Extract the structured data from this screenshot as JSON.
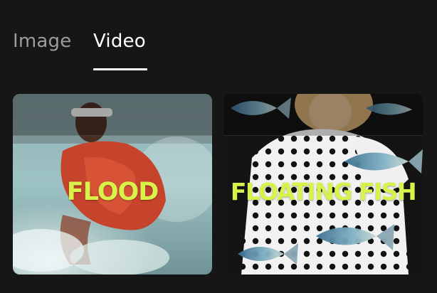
{
  "tabs": [
    {
      "label": "Image",
      "selected": false
    },
    {
      "label": "Video",
      "selected": true
    }
  ],
  "cards": [
    {
      "label": "FLOOD",
      "thumbnail": "woman-in-red-jacket-splashing-water"
    },
    {
      "label": "FLOATING FISH",
      "thumbnail": "woman-in-polka-dot-shirt-with-fish"
    }
  ],
  "colors": {
    "background": "#161616",
    "tab_active": "#ffffff",
    "tab_inactive": "#9c9c9c",
    "card_label": "#d9f24a"
  }
}
